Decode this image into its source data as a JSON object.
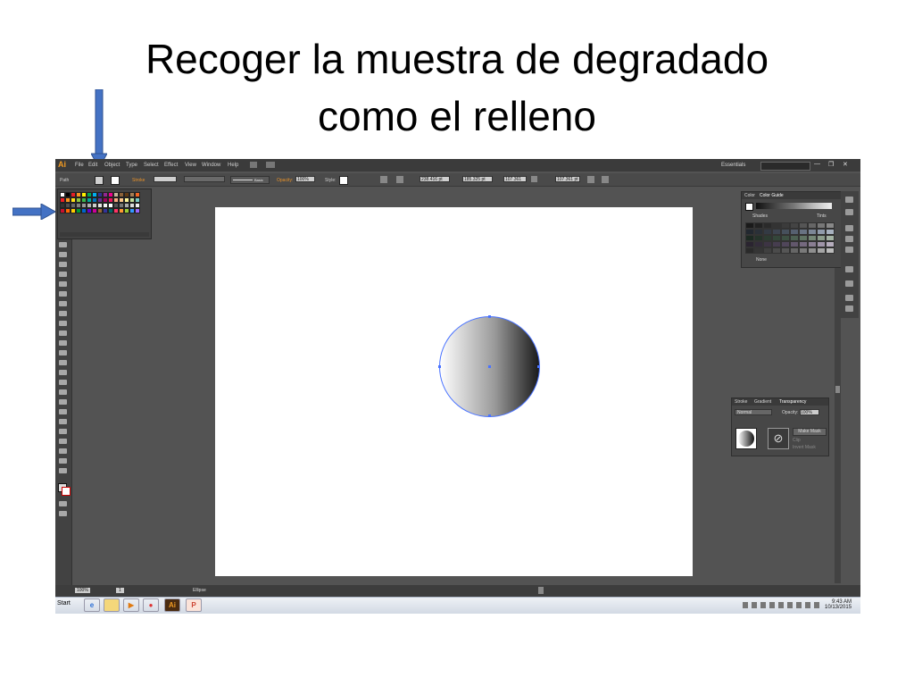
{
  "slide": {
    "title_line1": "Recoger la muestra de degradado",
    "title_line2": "como el relleno"
  },
  "app": {
    "logo": "Ai",
    "menu": [
      "File",
      "Edit",
      "Object",
      "Type",
      "Select",
      "Effect",
      "View",
      "Window",
      "Help"
    ],
    "workspace": "Essentials"
  },
  "control_bar": {
    "selection_label": "Path",
    "stroke_label": "Stroke",
    "brush_label": "Basic",
    "opacity_label": "Opacity:",
    "opacity_value": "100%",
    "style_label": "Style:",
    "x_value": "238.416 pt",
    "y_value": "185.325 pt",
    "w_value": "107.361 pt",
    "h_value": "107.361 pt"
  },
  "color_panel": {
    "tabs": [
      "Color",
      "Color Guide"
    ],
    "shades_label": "Shades",
    "tints_label": "Tints",
    "none_label": "None"
  },
  "transparency_panel": {
    "tabs": [
      "Stroke",
      "Gradient",
      "Transparency"
    ],
    "blend_mode": "Normal",
    "opacity_label": "Opacity:",
    "opacity_value": "100%",
    "make_mask": "Make Mask",
    "clip": "Clip",
    "invert_mask": "Invert Mask"
  },
  "status_bar": {
    "zoom": "100%",
    "page": "1",
    "tool": "Ellipse"
  },
  "taskbar": {
    "start": "Start",
    "time": "9:43 AM",
    "date": "10/13/2015"
  },
  "colors": {
    "arrow": "#4472c4",
    "ui_bg": "#535353",
    "artboard": "#ffffff",
    "accent_orange": "#f09a23",
    "selection_blue": "#4a73ff"
  }
}
